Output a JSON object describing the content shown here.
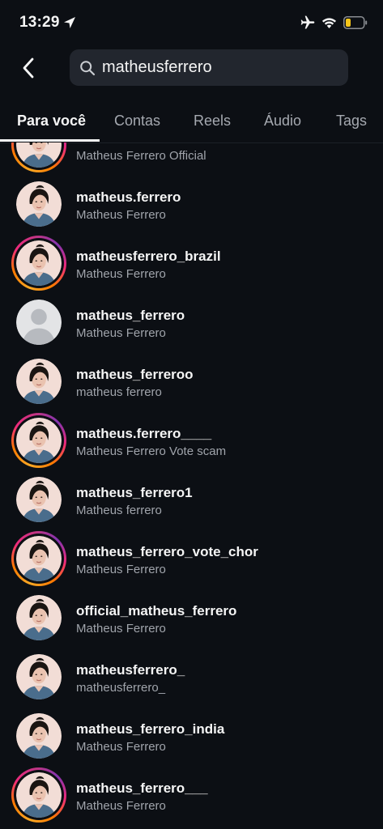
{
  "status_bar": {
    "time": "13:29",
    "icons": [
      "location-arrow-icon",
      "airplane-icon",
      "wifi-icon",
      "battery-low-icon"
    ],
    "battery_color": "#f5c518"
  },
  "header": {
    "back_icon": "chevron-left-icon",
    "search": {
      "value": "matheusferrero",
      "icon": "search-icon"
    }
  },
  "tabs": [
    {
      "label": "Para você",
      "active": true
    },
    {
      "label": "Contas",
      "active": false
    },
    {
      "label": "Reels",
      "active": false
    },
    {
      "label": "Áudio",
      "active": false
    },
    {
      "label": "Tags",
      "active": false
    }
  ],
  "results": [
    {
      "username": "",
      "fullname": "Matheus Ferrero Official",
      "story_ring": true,
      "avatar": "portrait"
    },
    {
      "username": "matheus.ferrero",
      "fullname": "Matheus Ferrero",
      "story_ring": false,
      "avatar": "portrait"
    },
    {
      "username": "matheusferrero_brazil",
      "fullname": "Matheus Ferrero",
      "story_ring": true,
      "avatar": "portrait"
    },
    {
      "username": "matheus_ferrero",
      "fullname": "Matheus Ferrero",
      "story_ring": false,
      "avatar": "default-user"
    },
    {
      "username": "matheus_ferreroo",
      "fullname": "matheus ferrero",
      "story_ring": false,
      "avatar": "portrait"
    },
    {
      "username": "matheus.ferrero____",
      "fullname": "Matheus Ferrero Vote scam",
      "story_ring": true,
      "avatar": "portrait"
    },
    {
      "username": "matheus_ferrero1",
      "fullname": "Matheus ferrero",
      "story_ring": false,
      "avatar": "portrait"
    },
    {
      "username": "matheus_ferrero_vote_chor",
      "fullname": "Matheus Ferrero",
      "story_ring": true,
      "avatar": "portrait"
    },
    {
      "username": "official_matheus_ferrero",
      "fullname": "Matheus Ferrero",
      "story_ring": false,
      "avatar": "portrait"
    },
    {
      "username": "matheusferrero_",
      "fullname": "matheusferrero_",
      "story_ring": false,
      "avatar": "portrait"
    },
    {
      "username": "matheus_ferrero_india",
      "fullname": "Matheus Ferrero",
      "story_ring": false,
      "avatar": "portrait"
    },
    {
      "username": "matheus_ferrero___",
      "fullname": "Matheus Ferrero",
      "story_ring": true,
      "avatar": "portrait"
    }
  ]
}
